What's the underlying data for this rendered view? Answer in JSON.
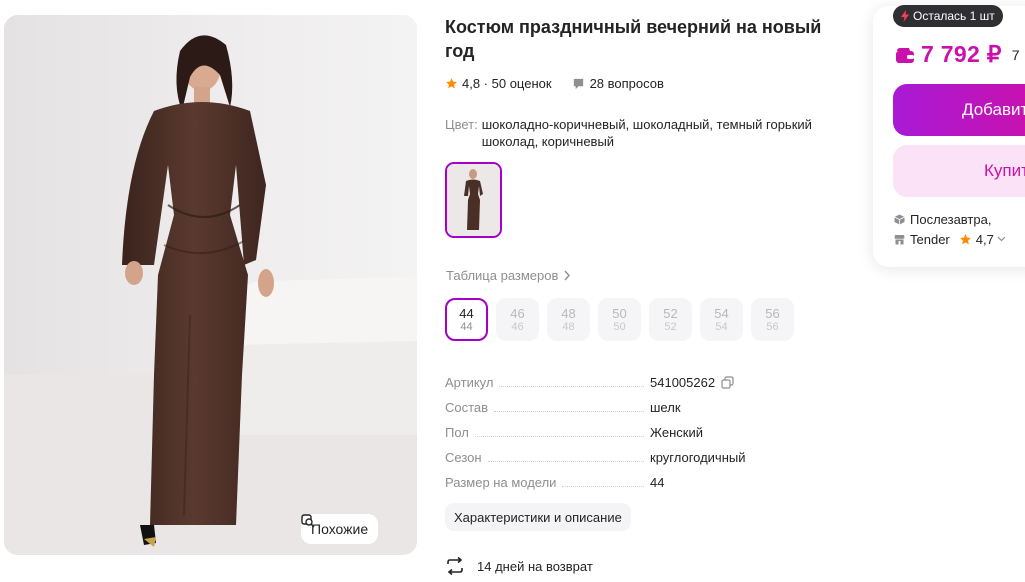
{
  "product": {
    "title": "Костюм праздничный вечерний на новый год",
    "rating": "4,8 · 50 оценок",
    "questions": "28 вопросов",
    "color_label": "Цвет:",
    "color_value": "шоколадно-коричневый, шоколадный, темный горький шоколад, коричневый",
    "similar_label": "Похожие"
  },
  "sizes": {
    "table_link": "Таблица размеров",
    "items": [
      {
        "main": "44",
        "sub": "44",
        "active": true
      },
      {
        "main": "46",
        "sub": "46",
        "active": false
      },
      {
        "main": "48",
        "sub": "48",
        "active": false
      },
      {
        "main": "50",
        "sub": "50",
        "active": false
      },
      {
        "main": "52",
        "sub": "52",
        "active": false
      },
      {
        "main": "54",
        "sub": "54",
        "active": false
      },
      {
        "main": "56",
        "sub": "56",
        "active": false
      }
    ]
  },
  "specs": [
    {
      "key": "Артикул",
      "value": "541005262"
    },
    {
      "key": "Состав",
      "value": "шелк"
    },
    {
      "key": "Пол",
      "value": "Женский"
    },
    {
      "key": "Сезон",
      "value": "круглогодичный"
    },
    {
      "key": "Размер на модели",
      "value": "44"
    }
  ],
  "characteristics_button": "Характеристики и описание",
  "return_policy": "14 дней на возврат",
  "buy": {
    "stock_badge": "Осталась 1 шт",
    "price": "7 792 ₽",
    "old_price": "7",
    "add_to_cart": "Добавить",
    "buy_now": "Купить",
    "delivery": "Послезавтра,",
    "seller": "Tender",
    "seller_rating": "4,7"
  },
  "icons": {
    "star": "star-icon",
    "question": "question-bubble-icon",
    "copy": "copy-icon",
    "return": "return-arrows-icon",
    "wallet": "wallet-icon",
    "lightning": "lightning-icon",
    "box": "box-icon",
    "shop": "shop-icon",
    "similar": "similar-search-icon"
  },
  "colors": {
    "accent": "#cb11ab",
    "accent_purple": "#a400c9",
    "rating_star": "#ff8c00",
    "text": "#242424",
    "muted": "#8e8e93"
  }
}
